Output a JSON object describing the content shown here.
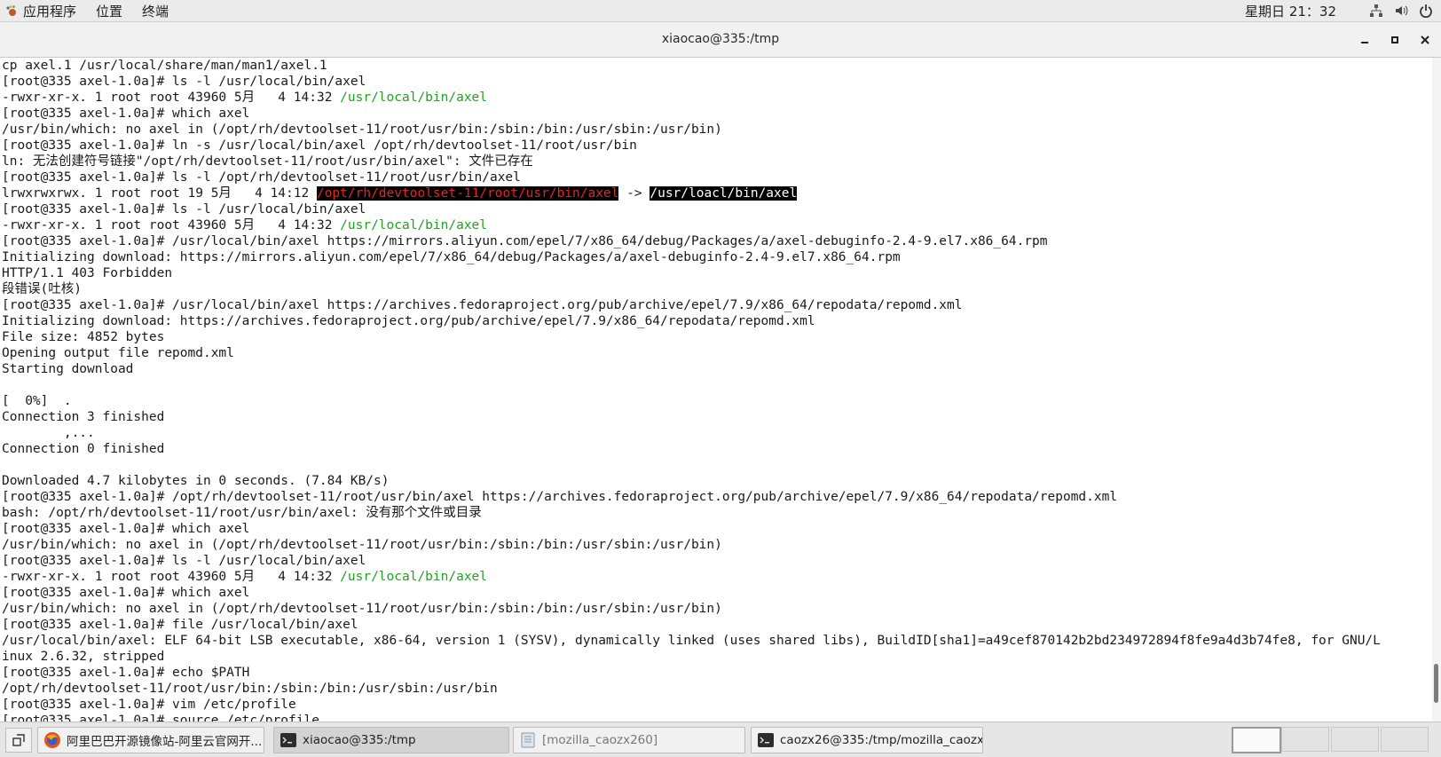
{
  "topbar": {
    "menus": [
      "应用程序",
      "位置",
      "终端"
    ],
    "clock": "星期日 21：32",
    "tray_icons": [
      "network-icon",
      "volume-icon",
      "power-icon"
    ]
  },
  "window": {
    "title": "xiaocao@335:/tmp",
    "controls": [
      "minimize",
      "maximize",
      "close"
    ]
  },
  "terminal": {
    "colors": {
      "green": "#1ea41e",
      "red": "#e8241e",
      "highlight_bg": "#000000"
    },
    "lines": [
      [
        {
          "t": "cp axel.1 /usr/local/share/man/man1/axel.1"
        }
      ],
      [
        {
          "t": "[root@335 axel-1.0a]# ls -l /usr/local/bin/axel"
        }
      ],
      [
        {
          "t": "-rwxr-xr-x. 1 root root 43960 5月   4 14:32 "
        },
        {
          "t": "/usr/local/bin/axel",
          "c": "green"
        }
      ],
      [
        {
          "t": "[root@335 axel-1.0a]# which axel"
        }
      ],
      [
        {
          "t": "/usr/bin/which: no axel in (/opt/rh/devtoolset-11/root/usr/bin:/sbin:/bin:/usr/sbin:/usr/bin)"
        }
      ],
      [
        {
          "t": "[root@335 axel-1.0a]# ln -s /usr/local/bin/axel /opt/rh/devtoolset-11/root/usr/bin"
        }
      ],
      [
        {
          "t": "ln: 无法创建符号链接\"/opt/rh/devtoolset-11/root/usr/bin/axel\": 文件已存在"
        }
      ],
      [
        {
          "t": "[root@335 axel-1.0a]# ls -l /opt/rh/devtoolset-11/root/usr/bin/axel"
        }
      ],
      [
        {
          "t": "lrwxrwxrwx. 1 root root 19 5月   4 14:12 "
        },
        {
          "t": "/opt/rh/devtoolset-11/root/usr/bin/axel",
          "c": "redhl"
        },
        {
          "t": " -> "
        },
        {
          "t": "/usr/loacl/bin/axel",
          "c": "whitehl"
        }
      ],
      [
        {
          "t": "[root@335 axel-1.0a]# ls -l /usr/local/bin/axel"
        }
      ],
      [
        {
          "t": "-rwxr-xr-x. 1 root root 43960 5月   4 14:32 "
        },
        {
          "t": "/usr/local/bin/axel",
          "c": "green"
        }
      ],
      [
        {
          "t": "[root@335 axel-1.0a]# /usr/local/bin/axel https://mirrors.aliyun.com/epel/7/x86_64/debug/Packages/a/axel-debuginfo-2.4-9.el7.x86_64.rpm"
        }
      ],
      [
        {
          "t": "Initializing download: https://mirrors.aliyun.com/epel/7/x86_64/debug/Packages/a/axel-debuginfo-2.4-9.el7.x86_64.rpm"
        }
      ],
      [
        {
          "t": "HTTP/1.1 403 Forbidden"
        }
      ],
      [
        {
          "t": "段错误(吐核)"
        }
      ],
      [
        {
          "t": "[root@335 axel-1.0a]# /usr/local/bin/axel https://archives.fedoraproject.org/pub/archive/epel/7.9/x86_64/repodata/repomd.xml"
        }
      ],
      [
        {
          "t": "Initializing download: https://archives.fedoraproject.org/pub/archive/epel/7.9/x86_64/repodata/repomd.xml"
        }
      ],
      [
        {
          "t": "File size: 4852 bytes"
        }
      ],
      [
        {
          "t": "Opening output file repomd.xml"
        }
      ],
      [
        {
          "t": "Starting download"
        }
      ],
      [
        {
          "t": ""
        }
      ],
      [
        {
          "t": "[  0%]  ."
        }
      ],
      [
        {
          "t": "Connection 3 finished"
        }
      ],
      [
        {
          "t": "        ,..."
        }
      ],
      [
        {
          "t": "Connection 0 finished"
        }
      ],
      [
        {
          "t": ""
        }
      ],
      [
        {
          "t": "Downloaded 4.7 kilobytes in 0 seconds. (7.84 KB/s)"
        }
      ],
      [
        {
          "t": "[root@335 axel-1.0a]# /opt/rh/devtoolset-11/root/usr/bin/axel https://archives.fedoraproject.org/pub/archive/epel/7.9/x86_64/repodata/repomd.xml"
        }
      ],
      [
        {
          "t": "bash: /opt/rh/devtoolset-11/root/usr/bin/axel: 没有那个文件或目录"
        }
      ],
      [
        {
          "t": "[root@335 axel-1.0a]# which axel"
        }
      ],
      [
        {
          "t": "/usr/bin/which: no axel in (/opt/rh/devtoolset-11/root/usr/bin:/sbin:/bin:/usr/sbin:/usr/bin)"
        }
      ],
      [
        {
          "t": "[root@335 axel-1.0a]# ls -l /usr/local/bin/axel"
        }
      ],
      [
        {
          "t": "-rwxr-xr-x. 1 root root 43960 5月   4 14:32 "
        },
        {
          "t": "/usr/local/bin/axel",
          "c": "green"
        }
      ],
      [
        {
          "t": "[root@335 axel-1.0a]# which axel"
        }
      ],
      [
        {
          "t": "/usr/bin/which: no axel in (/opt/rh/devtoolset-11/root/usr/bin:/sbin:/bin:/usr/sbin:/usr/bin)"
        }
      ],
      [
        {
          "t": "[root@335 axel-1.0a]# file /usr/local/bin/axel"
        }
      ],
      [
        {
          "t": "/usr/local/bin/axel: ELF 64-bit LSB executable, x86-64, version 1 (SYSV), dynamically linked (uses shared libs), BuildID[sha1]=a49cef870142b2bd234972894f8fe9a4d3b74fe8, for GNU/L"
        }
      ],
      [
        {
          "t": "inux 2.6.32, stripped"
        }
      ],
      [
        {
          "t": "[root@335 axel-1.0a]# echo $PATH"
        }
      ],
      [
        {
          "t": "/opt/rh/devtoolset-11/root/usr/bin:/sbin:/bin:/usr/sbin:/usr/bin"
        }
      ],
      [
        {
          "t": "[root@335 axel-1.0a]# vim /etc/profile"
        }
      ],
      [
        {
          "t": "[root@335 axel-1.0a]# source /etc/profile"
        }
      ]
    ]
  },
  "taskbar": {
    "tasks": [
      {
        "label": "阿里巴巴开源镜像站-阿里云官网开...",
        "icon": "firefox-icon",
        "active": false,
        "dim": false
      },
      {
        "label": "xiaocao@335:/tmp",
        "icon": "terminal-icon",
        "active": true,
        "dim": false
      },
      {
        "label": "[mozilla_caozx260]",
        "icon": "folder-icon",
        "active": false,
        "dim": true
      },
      {
        "label": "caozx26@335:/tmp/mozilla_caozx···",
        "icon": "terminal-icon",
        "active": false,
        "dim": false
      }
    ],
    "workspaces": 4,
    "current_workspace": 1
  }
}
